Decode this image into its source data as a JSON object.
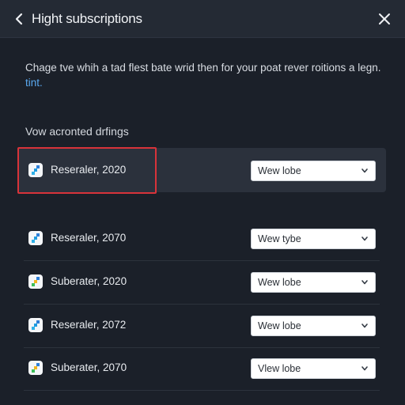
{
  "header": {
    "title": "Hight subscriptions"
  },
  "description": {
    "text": "Chage tve whih a tad flest bate wrid then for your poat rever roitions a legn.",
    "link": "tint."
  },
  "section": {
    "label": "Vow acronted drfings"
  },
  "rows": [
    {
      "label": "Reseraler, 2020",
      "select": "Wew lobe",
      "selected": true,
      "icon": "app-icon-blue"
    },
    {
      "label": "Reseraler, 2070",
      "select": "Wew tybe",
      "selected": false,
      "icon": "app-icon-blue"
    },
    {
      "label": "Suberater, 2020",
      "select": "Wew lobe",
      "selected": false,
      "icon": "app-icon-multicolor"
    },
    {
      "label": "Reseraler, 2072",
      "select": "Wew lobe",
      "selected": false,
      "icon": "app-icon-blue"
    },
    {
      "label": "Suberater, 2070",
      "select": "Vlew lobe",
      "selected": false,
      "icon": "app-icon-multicolor"
    }
  ],
  "colors": {
    "background": "#1b2029",
    "header": "#242a34",
    "selected_row": "#2b313c",
    "highlight": "#d8333a",
    "link": "#5aa9f0"
  }
}
